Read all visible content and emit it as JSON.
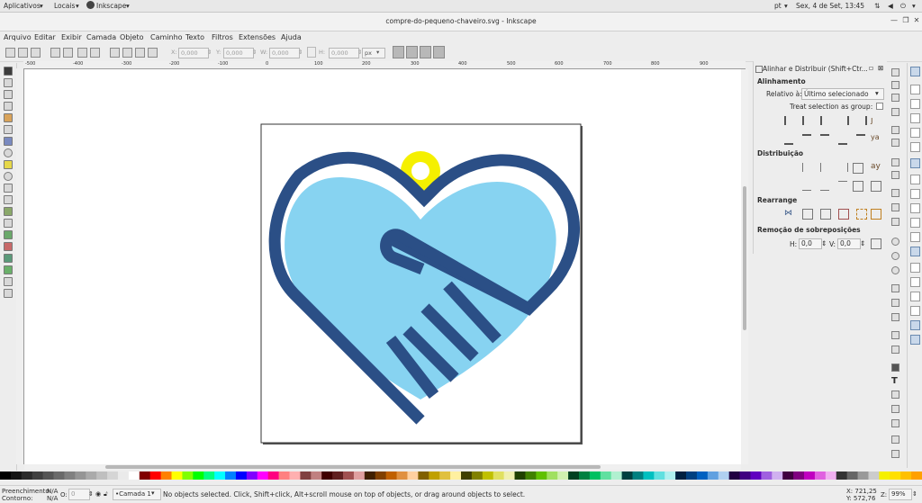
{
  "system_bar": {
    "apps_menu": "Aplicativos",
    "places_menu": "Locais",
    "app_menu": "Inkscape",
    "language": "pt",
    "clock": "Sex, 4 de Set, 13:45"
  },
  "window": {
    "title": "compre-do-pequeno-chaveiro.svg - Inkscape"
  },
  "menu": [
    "Arquivo",
    "Editar",
    "Exibir",
    "Camada",
    "Objeto",
    "Caminho",
    "Texto",
    "Filtros",
    "Extensões",
    "Ajuda"
  ],
  "toolbar": {
    "x_label": "X:",
    "x_value": "0,000",
    "y_label": "Y:",
    "y_value": "0,000",
    "w_label": "W:",
    "w_value": "0,000",
    "h_label": "H:",
    "h_value": "0,000",
    "unit": "px"
  },
  "ruler_labels": [
    "-500",
    "-400",
    "-300",
    "-200",
    "-100",
    "0",
    "100",
    "200",
    "300",
    "400",
    "500",
    "600",
    "700",
    "800",
    "900"
  ],
  "dock": {
    "title": "Alinhar e Distribuir (Shift+Ctr...",
    "align_heading": "Alinhamento",
    "relative_label": "Relativo à:",
    "relative_value": "Último selecionado",
    "treat_group_label": "Treat selection as group:",
    "distribute_heading": "Distribuição",
    "rearrange_heading": "Rearrange",
    "overlap_heading": "Remoção de sobreposições",
    "h_label": "H:",
    "h_value": "0,0",
    "v_label": "V:",
    "v_value": "0,0"
  },
  "colors": {
    "heart_fill": "#87d3f1",
    "heart_outline": "#2b4f86",
    "keyring": "#f5f000",
    "accent_selected": "#c9d8ea"
  },
  "status": {
    "fill_label": "Preenchimento:",
    "fill_value": "N/A",
    "stroke_label": "Contorno:",
    "stroke_value": "N/A",
    "opacity_label": "O:",
    "opacity_value": "0",
    "layer": "•Camada 1",
    "message": "No objects selected. Click, Shift+click, Alt+scroll mouse on top of objects, or drag around objects to select.",
    "coord_x": "X: 721,25",
    "coord_y": "Y: 572,76",
    "zoom_label": "Z:",
    "zoom_value": "99%"
  }
}
